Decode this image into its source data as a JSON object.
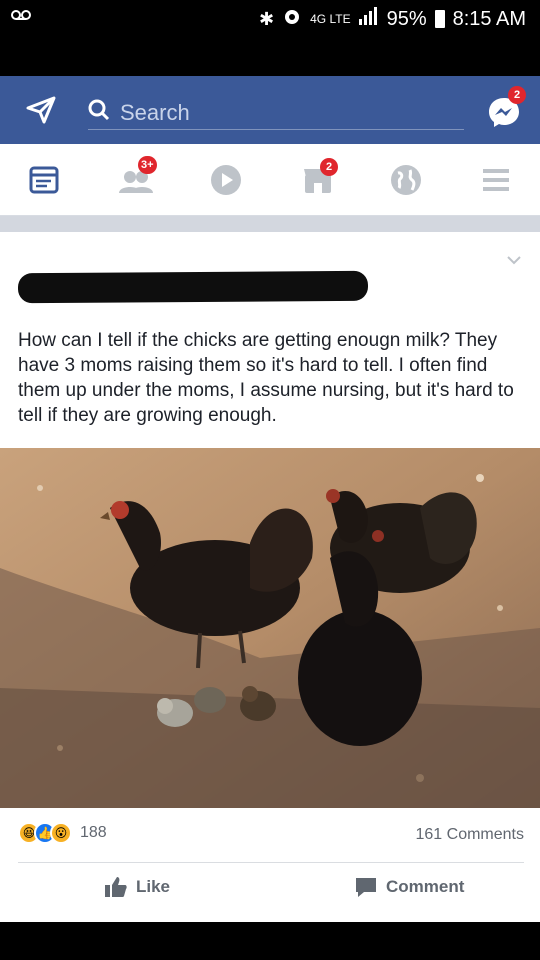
{
  "status_bar": {
    "left_icon": "voicemail-icon",
    "network": "4G LTE",
    "battery": "95%",
    "time": "8:15 AM"
  },
  "topbar": {
    "search_placeholder": "Search",
    "messenger_badge": "2",
    "color": "#3b5998"
  },
  "nav": {
    "friends_badge": "3+",
    "notifications_badge": "2",
    "items": [
      "news-feed",
      "friends",
      "watch",
      "marketplace",
      "notifications",
      "menu"
    ]
  },
  "post": {
    "text": "How can I tell if the chicks are getting enougn milk? They have 3 moms raising them so it's hard to tell. I often find them up under the moms, I assume nursing, but it's hard to tell if they are growing enough.",
    "reaction_count": "188",
    "comment_count": "161 Comments",
    "like_label": "Like",
    "comment_label": "Comment"
  }
}
